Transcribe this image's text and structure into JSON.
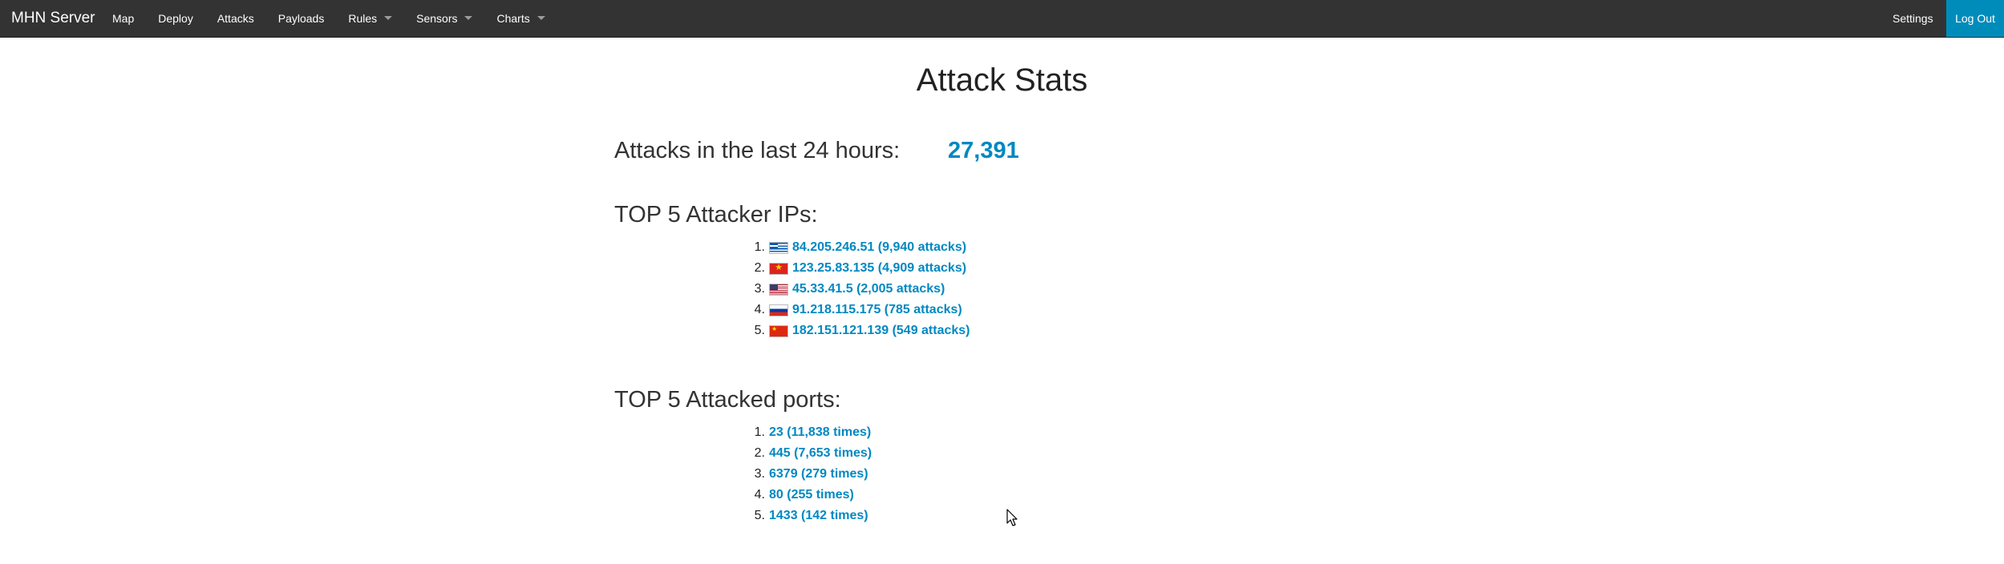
{
  "navbar": {
    "brand": "MHN Server",
    "items": [
      {
        "label": "Map"
      },
      {
        "label": "Deploy"
      },
      {
        "label": "Attacks"
      },
      {
        "label": "Payloads"
      },
      {
        "label": "Rules"
      },
      {
        "label": "Sensors"
      },
      {
        "label": "Charts"
      }
    ],
    "settings_label": "Settings",
    "logout_label": "Log Out"
  },
  "page": {
    "title": "Attack Stats",
    "attacks_label": "Attacks in the last 24 hours:",
    "attacks_count": "27,391"
  },
  "top_ips": {
    "heading": "TOP 5 Attacker IPs:",
    "items": [
      {
        "num": "1.",
        "country_flag": "greece-flag",
        "text": "84.205.246.51 (9,940 attacks)"
      },
      {
        "num": "2.",
        "country_flag": "vietnam-flag",
        "text": "123.25.83.135 (4,909 attacks)"
      },
      {
        "num": "3.",
        "country_flag": "usa-flag",
        "text": "45.33.41.5 (2,005 attacks)"
      },
      {
        "num": "4.",
        "country_flag": "russia-flag",
        "text": "91.218.115.175 (785 attacks)"
      },
      {
        "num": "5.",
        "country_flag": "china-flag",
        "text": "182.151.121.139 (549 attacks)"
      }
    ]
  },
  "top_ports": {
    "heading": "TOP 5 Attacked ports:",
    "items": [
      {
        "num": "1.",
        "text": "23 (11,838 times)"
      },
      {
        "num": "2.",
        "text": "445 (7,653 times)"
      },
      {
        "num": "3.",
        "text": "6379 (279 times)"
      },
      {
        "num": "4.",
        "text": "80 (255 times)"
      },
      {
        "num": "5.",
        "text": "1433 (142 times)"
      }
    ]
  },
  "colors": {
    "navbar_bg": "#333333",
    "accent": "#008cba",
    "link": "#0088c2"
  }
}
